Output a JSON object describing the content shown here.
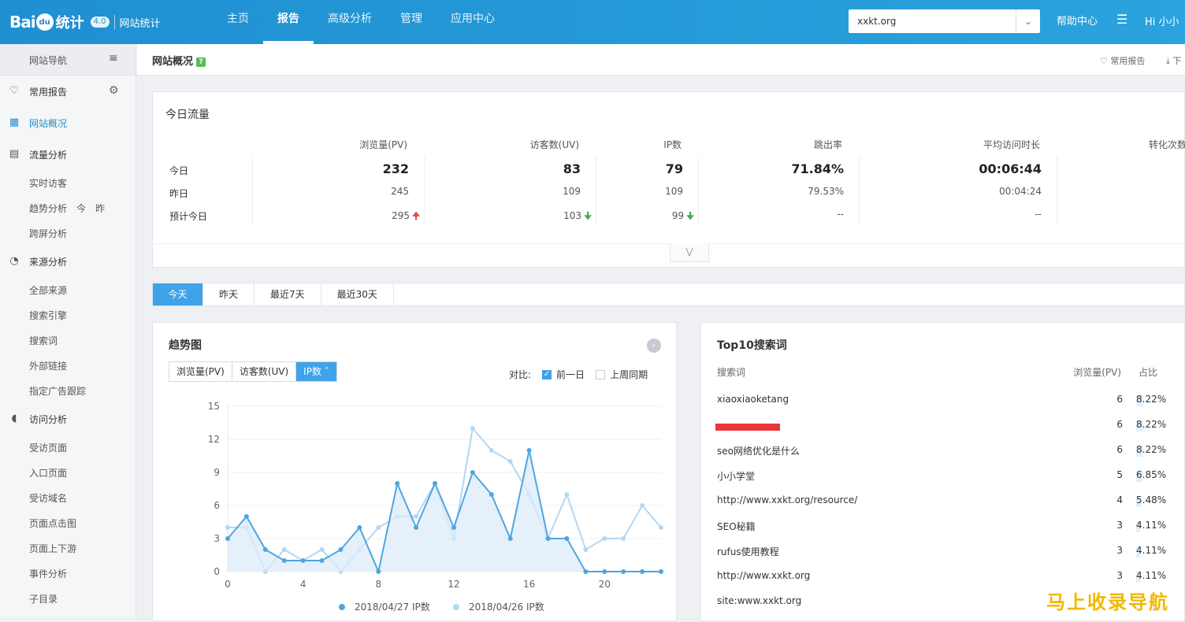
{
  "app": {
    "logo_text": "Bai",
    "logo_paw": "du",
    "logo_tongji": "统计",
    "version": "4.0",
    "subtitle": "网站统计"
  },
  "nav": {
    "items": [
      "主页",
      "报告",
      "高级分析",
      "管理",
      "应用中心"
    ],
    "active_index": 1
  },
  "site_select": {
    "value": "xxkt.org"
  },
  "top_right": {
    "help": "帮助中心",
    "user": "Hi 小小"
  },
  "sidebar": {
    "header": "网站导航",
    "sections": [
      {
        "label": "常用报告",
        "icon": "heart-icon"
      },
      {
        "label": "网站概况",
        "icon": "overview-icon"
      },
      {
        "label": "流量分析",
        "icon": "chart-icon"
      },
      {
        "label": "来源分析",
        "icon": "pie-icon"
      },
      {
        "label": "访问分析",
        "icon": "spiral-icon"
      }
    ],
    "traffic_items": [
      "实时访客",
      "趋势分析",
      "跨屏分析"
    ],
    "trend_extra": [
      "今",
      "昨"
    ],
    "source_items": [
      "全部来源",
      "搜索引擎",
      "搜索词",
      "外部链接",
      "指定广告跟踪"
    ],
    "visit_items": [
      "受访页面",
      "入口页面",
      "受访域名",
      "页面点击图",
      "页面上下游",
      "事件分析",
      "子目录"
    ]
  },
  "page": {
    "title": "网站概况",
    "help_badge": "?",
    "fav": "常用报告",
    "download": "下"
  },
  "today": {
    "title": "今日流量",
    "headers": [
      "浏览量(PV)",
      "访客数(UV)",
      "IP数",
      "跳出率",
      "平均访问时长",
      "转化次数"
    ],
    "rows": [
      {
        "label": "今日",
        "values": [
          "232",
          "83",
          "79",
          "71.84%",
          "00:06:44",
          "-"
        ]
      },
      {
        "label": "昨日",
        "values": [
          "245",
          "109",
          "109",
          "79.53%",
          "00:04:24",
          ""
        ]
      },
      {
        "label": "预计今日",
        "values": [
          "295",
          "103",
          "99",
          "--",
          "--",
          ""
        ]
      }
    ],
    "trend_arrows": [
      "up",
      "down",
      "down"
    ]
  },
  "tabs": [
    "今天",
    "昨天",
    "最近7天",
    "最近30天"
  ],
  "trend": {
    "title": "趋势图",
    "metric_tabs": [
      "浏览量(PV)",
      "访客数(UV)",
      "IP数"
    ],
    "active_metric": 2,
    "compare_label": "对比:",
    "compare_options": [
      {
        "label": "前一日",
        "checked": true
      },
      {
        "label": "上周同期",
        "checked": false
      }
    ]
  },
  "top10": {
    "title": "Top10搜索词",
    "headers": [
      "搜索词",
      "浏览量(PV)",
      "占比"
    ],
    "rows": [
      {
        "keyword": "xiaoxiaoketang",
        "pv": "6",
        "pct": "8.22%"
      },
      {
        "keyword": "",
        "pv": "6",
        "pct": "8.22%",
        "redacted": true
      },
      {
        "keyword": "seo网络优化是什么",
        "pv": "6",
        "pct": "8.22%"
      },
      {
        "keyword": "小小学堂",
        "pv": "5",
        "pct": "6.85%"
      },
      {
        "keyword": "http://www.xxkt.org/resource/",
        "pv": "4",
        "pct": "5.48%"
      },
      {
        "keyword": "SEO秘籍",
        "pv": "3",
        "pct": "4.11%"
      },
      {
        "keyword": "rufus使用教程",
        "pv": "3",
        "pct": "4.11%"
      },
      {
        "keyword": "http://www.xxkt.org",
        "pv": "3",
        "pct": "4.11%"
      },
      {
        "keyword": "site:www.xxkt.org",
        "pv": "",
        "pct": ""
      }
    ]
  },
  "watermark": "马上收录导航",
  "colors": {
    "brand": "#1f8fd1",
    "series_today": "#4da6e0",
    "series_prev": "#b3d8f2",
    "up": "#e4483f",
    "down": "#3fae53"
  },
  "chart_data": {
    "type": "line",
    "x": [
      0,
      1,
      2,
      3,
      4,
      5,
      6,
      7,
      8,
      9,
      10,
      11,
      12,
      13,
      14,
      15,
      16,
      17,
      18,
      19,
      20,
      21,
      22,
      23
    ],
    "xticks": [
      0,
      4,
      8,
      12,
      16,
      20
    ],
    "yticks": [
      0,
      3,
      6,
      9,
      12,
      15
    ],
    "ylim": [
      0,
      15
    ],
    "xlim": [
      0,
      23
    ],
    "grid": true,
    "series": [
      {
        "name": "2018/04/27 IP数",
        "values": [
          3,
          5,
          2,
          1,
          1,
          1,
          2,
          4,
          0,
          8,
          4,
          8,
          4,
          9,
          7,
          3,
          11,
          3,
          3,
          0,
          0,
          0,
          0,
          0
        ],
        "filled": true
      },
      {
        "name": "2018/04/26 IP数",
        "values": [
          4,
          4,
          0,
          2,
          1,
          2,
          0,
          2,
          4,
          5,
          5,
          8,
          3,
          13,
          11,
          10,
          7,
          3,
          7,
          2,
          3,
          3,
          6,
          4
        ],
        "filled": false
      }
    ],
    "legend_position": "bottom"
  }
}
